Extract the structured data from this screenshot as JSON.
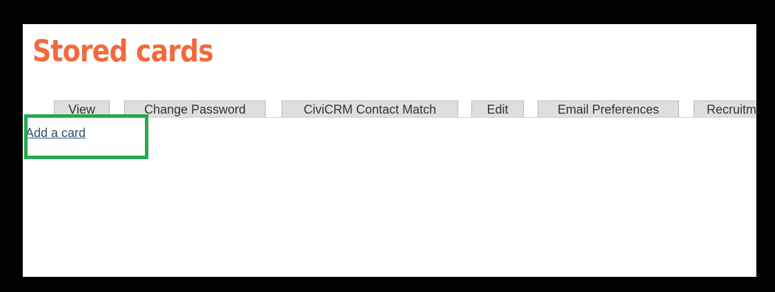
{
  "page": {
    "title": "Stored cards",
    "tabs": [
      {
        "label": "View"
      },
      {
        "label": "Change Password"
      },
      {
        "label": "CiviCRM Contact Match"
      },
      {
        "label": "Edit"
      },
      {
        "label": "Email Preferences"
      },
      {
        "label": "Recruitm"
      }
    ],
    "add_card_link": "Add a card"
  },
  "colors": {
    "title": "#f26a3c",
    "highlight": "#23a94e",
    "frame": "#000000",
    "link": "#2a4f6e"
  }
}
